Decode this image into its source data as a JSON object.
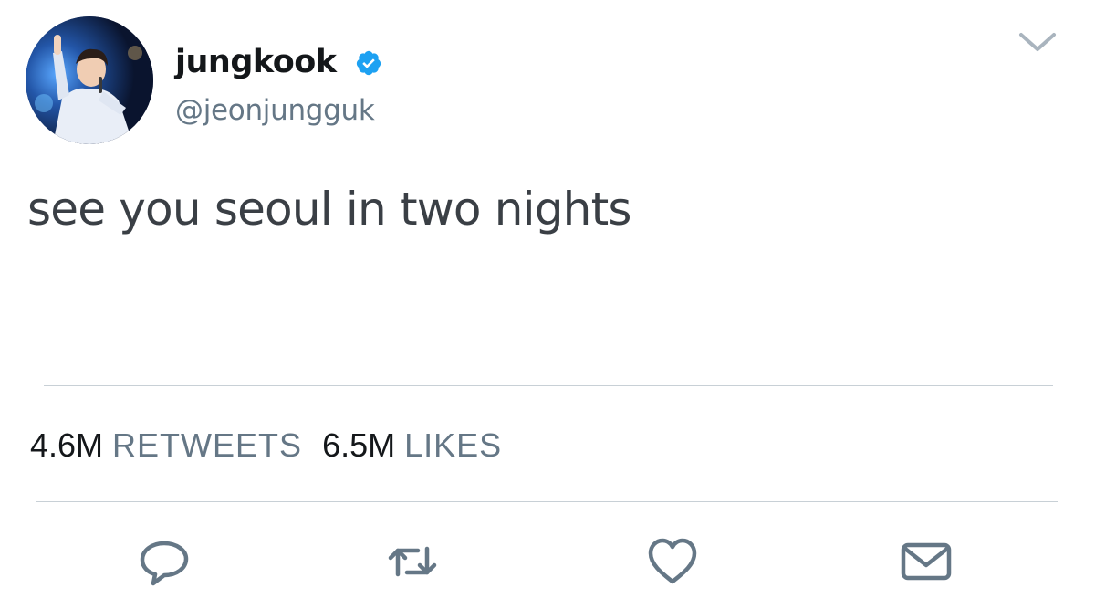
{
  "user": {
    "display_name": "jungkook",
    "handle": "@jeonjungguk",
    "verified": true,
    "avatar_icon": "profile-photo"
  },
  "tweet": {
    "text": "see you seoul in two nights"
  },
  "stats": {
    "retweets_count": "4.6M",
    "retweets_label": "RETWEETS",
    "likes_count": "6.5M",
    "likes_label": "LIKES"
  },
  "actions": {
    "reply_icon": "speech-bubble-icon",
    "retweet_icon": "retweet-icon",
    "like_icon": "heart-icon",
    "dm_icon": "envelope-icon",
    "menu_icon": "chevron-down-icon"
  },
  "colors": {
    "text_primary": "#14171a",
    "text_secondary": "#657786",
    "verified_blue": "#1da1f2",
    "icon_gray": "#657786",
    "divider": "#c8d0d6"
  }
}
